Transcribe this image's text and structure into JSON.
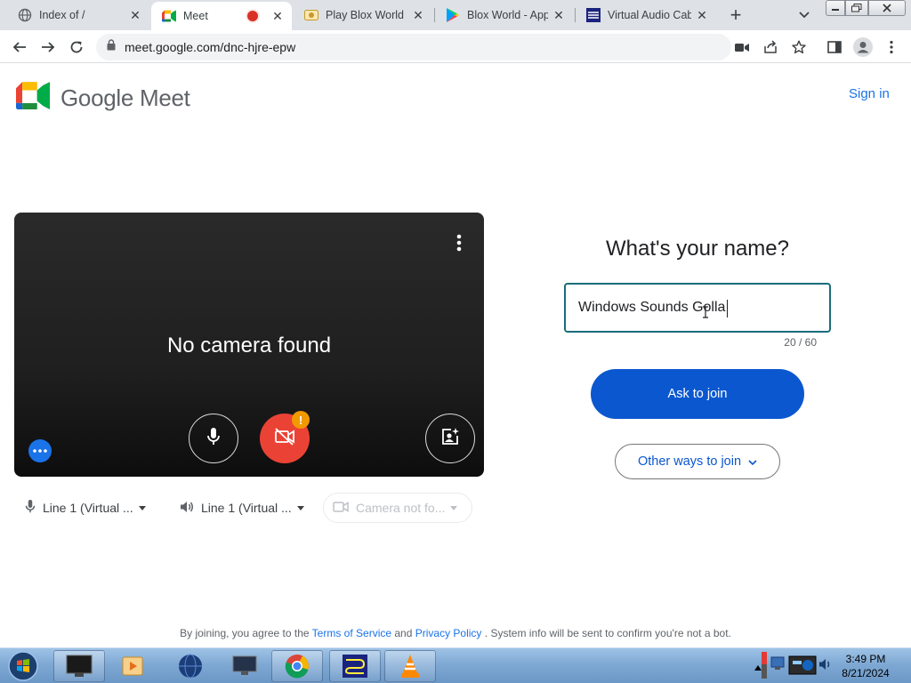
{
  "browser": {
    "tabs": [
      {
        "title": "Index of /",
        "icon": "globe-icon",
        "active": false
      },
      {
        "title": "Meet",
        "icon": "meet-icon",
        "active": true,
        "recording": true
      },
      {
        "title": "Play Blox World a",
        "icon": "game-icon",
        "active": false
      },
      {
        "title": "Blox World - App",
        "icon": "play-store-icon",
        "active": false
      },
      {
        "title": "Virtual Audio Cab",
        "icon": "vac-icon",
        "active": false
      }
    ],
    "url": "meet.google.com/dnc-hjre-epw"
  },
  "meet": {
    "brand": "Google Meet",
    "sign_in": "Sign in",
    "preview": {
      "message": "No camera found",
      "warning": "!"
    },
    "devices": {
      "mic": "Line 1 (Virtual ...",
      "speaker": "Line 1 (Virtual ...",
      "camera": "Camera not fo..."
    },
    "join": {
      "heading": "What's your name?",
      "name_value": "Windows Sounds Golla",
      "char_count": "20 / 60",
      "ask_to_join": "Ask to join",
      "other_ways": "Other ways to join"
    },
    "footer": {
      "prefix": "By joining, you agree to the",
      "terms": "Terms of Service",
      "and": "and",
      "privacy": "Privacy Policy",
      "suffix": ". System info will be sent to confirm you're not a bot."
    }
  },
  "taskbar": {
    "time": "3:49 PM",
    "date": "8/21/2024"
  },
  "colors": {
    "accent": "#0b57d0",
    "link": "#1a73e8",
    "cam_off": "#ea4335",
    "warning": "#f29900"
  }
}
